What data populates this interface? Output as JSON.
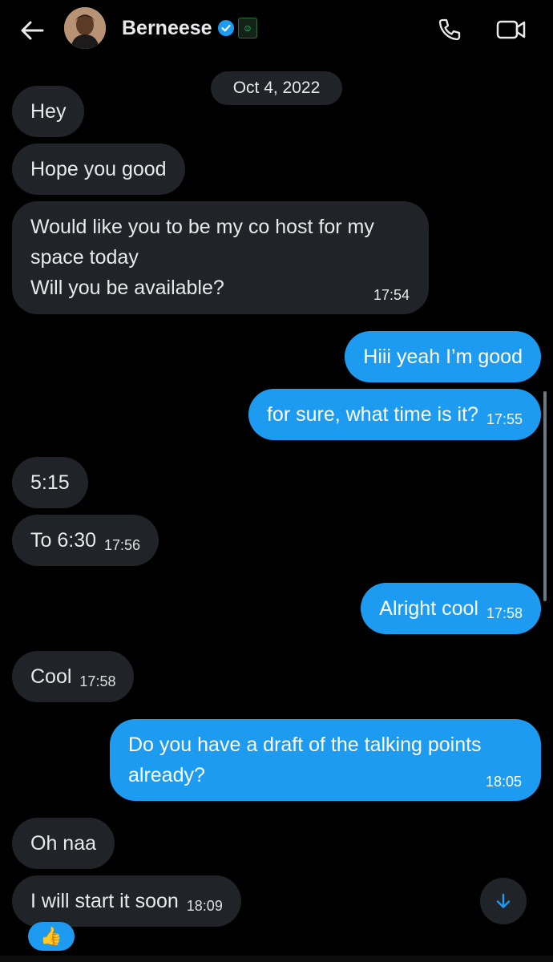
{
  "header": {
    "back_icon": "arrow-left-icon",
    "contact_name": "Berneese",
    "verified_icon": "verified-badge-icon",
    "affiliate_badge_icon": "green-affiliate-badge-icon",
    "call_icon": "phone-icon",
    "video_icon": "video-camera-icon"
  },
  "date_separator": "Oct 4, 2022",
  "messages": [
    {
      "dir": "received",
      "text": "Hey",
      "time": ""
    },
    {
      "dir": "received",
      "text": "Hope you good",
      "time": ""
    },
    {
      "dir": "received",
      "lines": [
        "Would like you to be my co host for my",
        "space today",
        "Will you be available?"
      ],
      "time": "17:54"
    },
    {
      "dir": "sent",
      "text": "Hiii yeah I’m good",
      "time": ""
    },
    {
      "dir": "sent",
      "text": "for sure, what time is it?",
      "time": "17:55"
    },
    {
      "dir": "received",
      "text": "5:15",
      "time": ""
    },
    {
      "dir": "received",
      "text": "To 6:30",
      "time": "17:56"
    },
    {
      "dir": "sent",
      "text": "Alright cool",
      "time": "17:58"
    },
    {
      "dir": "received",
      "text": "Cool",
      "time": "17:58"
    },
    {
      "dir": "sent",
      "lines": [
        "Do you have a draft of the talking points",
        "already?"
      ],
      "time": "18:05"
    },
    {
      "dir": "received",
      "text": "Oh naa",
      "time": ""
    },
    {
      "dir": "received",
      "text": "I will start it soon",
      "time": "18:09"
    }
  ],
  "reaction": "👍",
  "scroll_down_icon": "arrow-down-icon",
  "colors": {
    "background": "#000000",
    "received_bubble": "#202327",
    "sent_bubble": "#1d9bf0",
    "accent": "#1d9bf0"
  }
}
